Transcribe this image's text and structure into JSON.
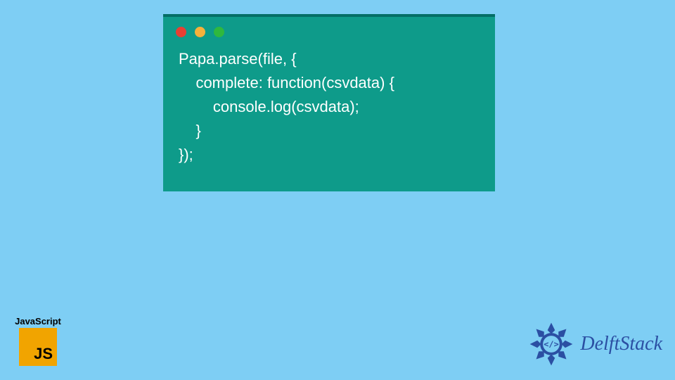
{
  "code_window": {
    "lines": [
      "Papa.parse(file, {",
      "    complete: function(csvdata) {",
      "        console.log(csvdata);",
      "    }",
      "});"
    ],
    "dots": [
      "red",
      "yellow",
      "green"
    ]
  },
  "js_badge": {
    "label": "JavaScript",
    "abbr": "JS",
    "bg_color": "#f1a400"
  },
  "delftstack": {
    "brand": "DelftStack",
    "color": "#2b4fa3"
  }
}
